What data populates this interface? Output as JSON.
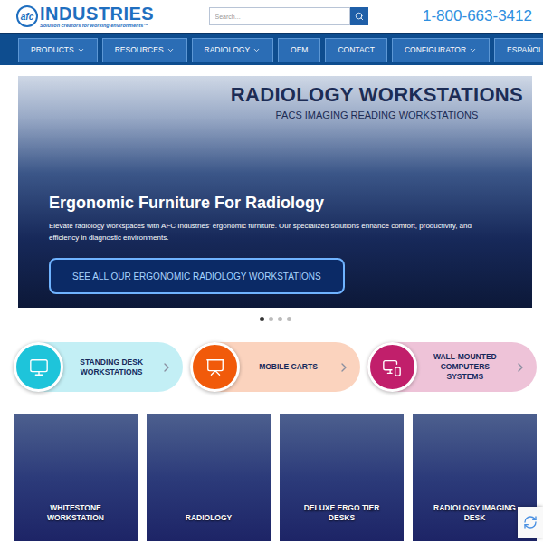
{
  "header": {
    "logo": {
      "mark": "afc",
      "name": "INDUSTRIES",
      "tagline": "Solution creators for working environments™"
    },
    "search": {
      "placeholder": "Search..."
    },
    "phone": "1-800-663-3412"
  },
  "nav": [
    {
      "label": "PRODUCTS",
      "dropdown": true
    },
    {
      "label": "RESOURCES",
      "dropdown": true
    },
    {
      "label": "RADIOLOGY",
      "dropdown": true
    },
    {
      "label": "OEM",
      "dropdown": false
    },
    {
      "label": "CONTACT",
      "dropdown": false
    },
    {
      "label": "CONFIGURATOR",
      "dropdown": true
    },
    {
      "label": "ESPAÑOL",
      "dropdown": false
    }
  ],
  "hero": {
    "heading": "RADIOLOGY WORKSTATIONS",
    "subheading": "PACS IMAGING READING WORKSTATIONS",
    "title": "Ergonomic Furniture For Radiology",
    "description": "Elevate radiology workspaces with AFC Industries' ergonomic furniture. Our specialized solutions enhance comfort, productivity, and efficiency in diagnostic environments.",
    "button": "SEE ALL OUR ERGONOMIC RADIOLOGY WORKSTATIONS"
  },
  "slides": [
    {
      "selected": true
    },
    {
      "selected": false
    },
    {
      "selected": false
    },
    {
      "selected": false
    }
  ],
  "categories": [
    {
      "label": "STANDING DESK WORKSTATIONS",
      "color": "#1ec4da"
    },
    {
      "label": "MOBILE CARTS",
      "color": "#f15a0a"
    },
    {
      "label": "WALL-MOUNTED COMPUTERS SYSTEMS",
      "color": "#c11f6b"
    }
  ],
  "products": [
    {
      "label": "WHITESTONE WORKSTATION"
    },
    {
      "label": "RADIOLOGY"
    },
    {
      "label": "DELUXE ERGO TIER DESKS"
    },
    {
      "label": "RADIOLOGY IMAGING DESK"
    }
  ]
}
